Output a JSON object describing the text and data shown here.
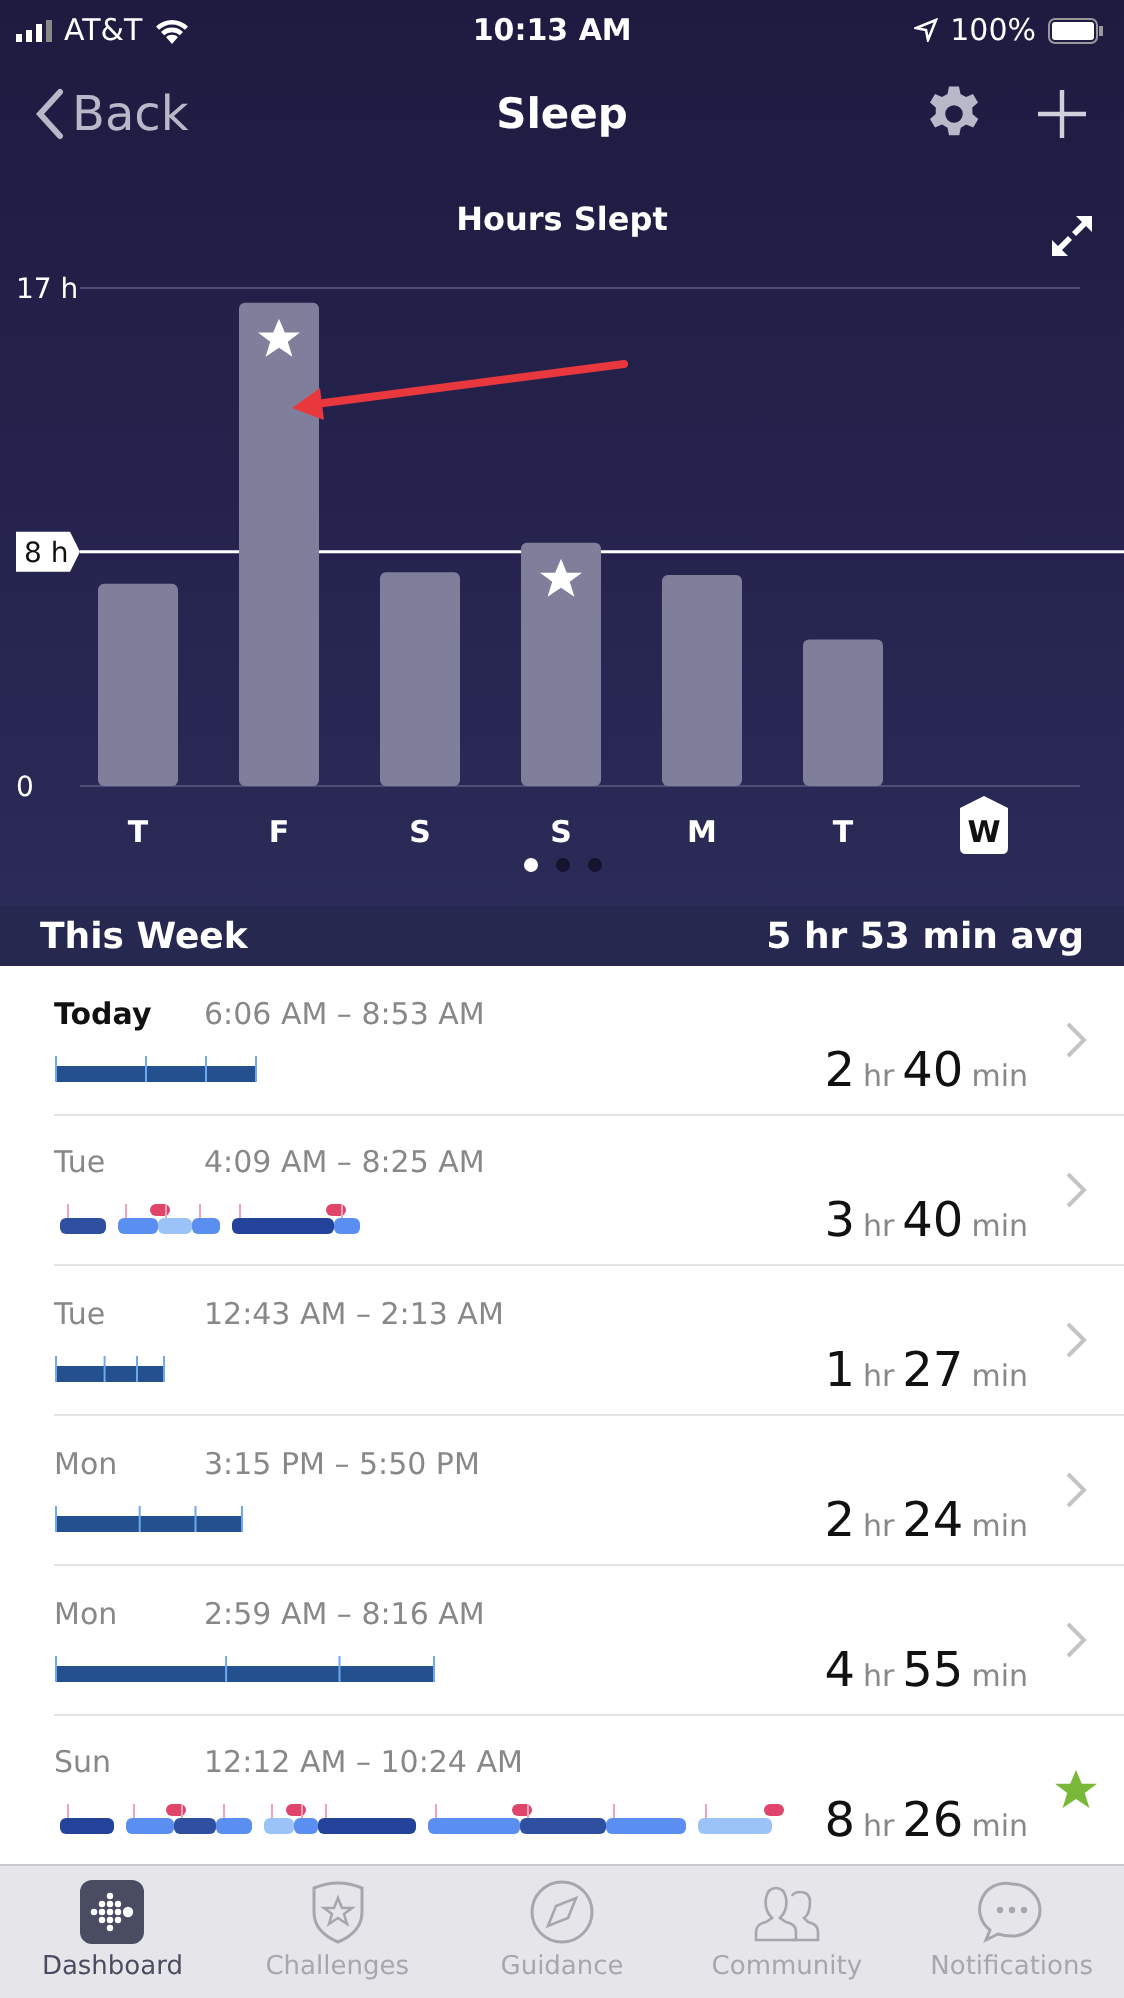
{
  "status_bar": {
    "carrier": "AT&T",
    "time": "10:13 AM",
    "battery": "100%"
  },
  "nav": {
    "back": "Back",
    "title": "Sleep"
  },
  "chart": {
    "chart_data": {
      "type": "bar",
      "title": "Hours Slept",
      "categories": [
        "T",
        "F",
        "S",
        "S",
        "M",
        "T",
        "W"
      ],
      "values": [
        6.9,
        16.5,
        7.3,
        8.3,
        7.2,
        5.0,
        null
      ],
      "yticks": [
        {
          "value": 0,
          "label": "0"
        },
        {
          "value": 8,
          "label": "8 h"
        },
        {
          "value": 17,
          "label": "17 h"
        }
      ],
      "ylim": [
        0,
        17
      ]
    },
    "goal_stars": [
      false,
      true,
      false,
      true,
      false,
      false
    ],
    "selected_days": [
      false,
      false,
      false,
      false,
      false,
      false,
      true
    ],
    "pager": [
      {
        "selected": true
      },
      {
        "selected": false
      },
      {
        "selected": false
      }
    ]
  },
  "summary": {
    "label": "This Week",
    "average": "5 hr 53 min avg"
  },
  "entries": [
    {
      "day": "Today",
      "current": true,
      "time": "6:06 AM – 8:53 AM",
      "hours": "2",
      "hr_unit": "hr",
      "minutes": "40",
      "min_unit": "min",
      "kind": "simple",
      "goal_met": false
    },
    {
      "day": "Tue",
      "current": false,
      "time": "4:09 AM – 8:25 AM",
      "hours": "3",
      "hr_unit": "hr",
      "minutes": "40",
      "min_unit": "min",
      "kind": "stages",
      "goal_met": false
    },
    {
      "day": "Tue",
      "current": false,
      "time": "12:43 AM – 2:13 AM",
      "hours": "1",
      "hr_unit": "hr",
      "minutes": "27",
      "min_unit": "min",
      "kind": "simple",
      "goal_met": false
    },
    {
      "day": "Mon",
      "current": false,
      "time": "3:15 PM – 5:50 PM",
      "hours": "2",
      "hr_unit": "hr",
      "minutes": "24",
      "min_unit": "min",
      "kind": "simple",
      "goal_met": false
    },
    {
      "day": "Mon",
      "current": false,
      "time": "2:59 AM – 8:16 AM",
      "hours": "4",
      "hr_unit": "hr",
      "minutes": "55",
      "min_unit": "min",
      "kind": "simple",
      "goal_met": false
    },
    {
      "day": "Sun",
      "current": false,
      "time": "12:12 AM – 10:24 AM",
      "hours": "8",
      "hr_unit": "hr",
      "minutes": "26",
      "min_unit": "min",
      "kind": "stages",
      "goal_met": true
    }
  ],
  "tabs": [
    {
      "label": "Dashboard",
      "selected": true
    },
    {
      "label": "Challenges",
      "selected": false
    },
    {
      "label": "Guidance",
      "selected": false
    },
    {
      "label": "Community",
      "selected": false
    },
    {
      "label": "Notifications",
      "selected": false
    }
  ]
}
